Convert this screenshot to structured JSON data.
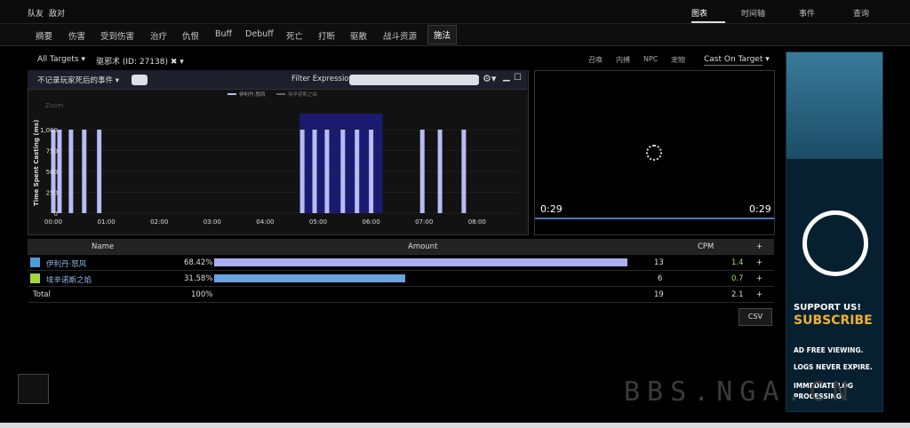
{
  "top": {
    "left_links": [
      "队友",
      "敌对"
    ],
    "nav": [
      "图表",
      "时间轴",
      "事件",
      "查询"
    ],
    "active_nav": "图表"
  },
  "tabs": [
    "摘要",
    "伤害",
    "受到伤害",
    "治疗",
    "仇恨",
    "Buff",
    "Debuff",
    "死亡",
    "打断",
    "驱散",
    "战斗资源",
    "施法"
  ],
  "active_tab": "施法",
  "filters": {
    "all_targets": "All Targets",
    "spell": "驱邪术 (ID: 27138)",
    "options": [
      "召唤",
      "内搏",
      "NPC",
      "宠物"
    ],
    "cast_on_target": "Cast On Target"
  },
  "chart_panel": {
    "dropdown": "不记录玩家死后的事件",
    "filter_label": "Filter Expression:",
    "filter_value": "",
    "zoom": "Zoom"
  },
  "chart_data": {
    "type": "bar",
    "title": "",
    "ylabel": "Time Spent Casting (ms)",
    "xlabel": "",
    "legend": [
      "伊利丹·怒风",
      "埃辛诺斯之焰"
    ],
    "legend_position": "top-center",
    "y_ticks": [
      "0",
      "250",
      "500",
      "750",
      "1,000"
    ],
    "ylim": [
      0,
      1000
    ],
    "x_ticks": [
      "00:00",
      "01:00",
      "02:00",
      "03:00",
      "04:00",
      "05:00",
      "06:00",
      "07:00",
      "08:00"
    ],
    "highlight_range": [
      "04:42",
      "06:10"
    ],
    "series": [
      {
        "name": "伊利丹·怒风",
        "color": "#b8bcf2",
        "x": [
          "00:00",
          "00:07",
          "00:20",
          "00:35",
          "00:52",
          "04:42",
          "04:56",
          "05:10",
          "05:28",
          "05:44",
          "06:00",
          "06:58",
          "07:18",
          "07:45"
        ],
        "values": [
          1000,
          1000,
          1000,
          1000,
          1000,
          1000,
          1000,
          1000,
          1000,
          1000,
          1000,
          1000,
          1000,
          1000
        ]
      }
    ]
  },
  "video": {
    "time_left": "0:29",
    "time_right": "0:29"
  },
  "table": {
    "headers": [
      "Name",
      "Amount",
      "CPM",
      "+"
    ],
    "rows": [
      {
        "name": "伊利丹·怒风",
        "pct": "68.42%",
        "fraction": 0.6842,
        "count": "13",
        "cpm": "1.4",
        "plus": "+",
        "color": "#a8aef0",
        "icon_color": "#4a9fd8",
        "cpm_color": "#9be36a"
      },
      {
        "name": "埃辛诺斯之焰",
        "pct": "31.58%",
        "fraction": 0.3158,
        "count": "6",
        "cpm": "0.7",
        "plus": "+",
        "color": "#6aa3dd",
        "icon_color": "#a5d83c",
        "cpm_color": "#9be36a"
      }
    ],
    "total": {
      "label": "Total",
      "pct": "100%",
      "count": "19",
      "cpm": "2.1",
      "plus": "+"
    }
  },
  "csv_button": "CSV",
  "ad": {
    "line1": "SUPPORT US!",
    "line2": "SUBSCRIBE",
    "features": [
      "AD FREE VIEWING.",
      "LOGS NEVER EXPIRE.",
      "IMMEDIATE LOG",
      "PROCESSING."
    ]
  },
  "watermark": "BBS.NGA.CN"
}
